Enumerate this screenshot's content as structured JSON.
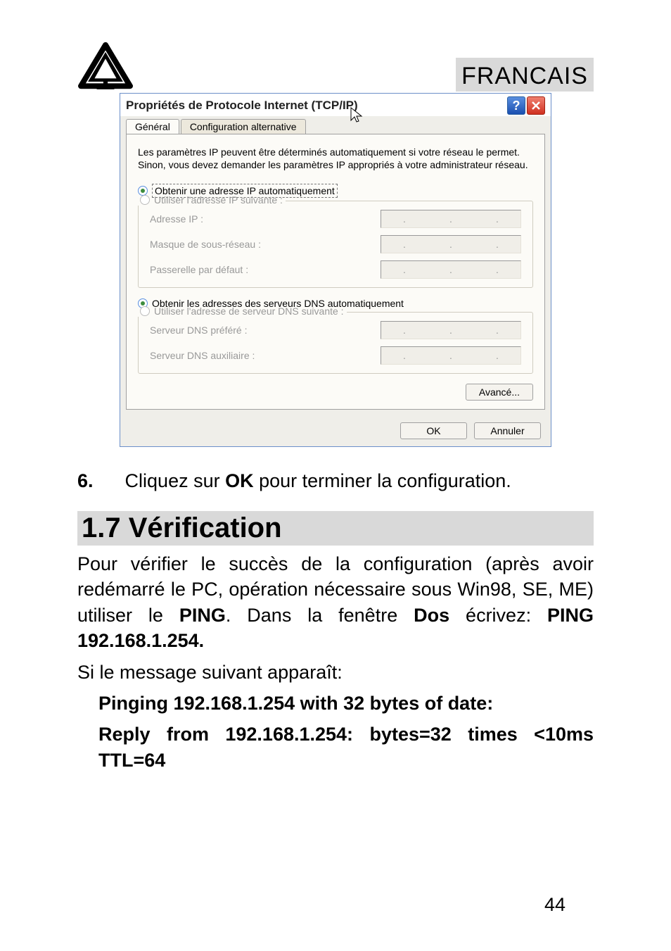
{
  "header": {
    "language": "FRANCAIS"
  },
  "dialog": {
    "title": "Propriétés de Protocole Internet (TCP/IP)",
    "tabs": [
      "Général",
      "Configuration alternative"
    ],
    "description": "Les paramètres IP peuvent être déterminés automatiquement si votre réseau le permet. Sinon, vous devez demander les paramètres IP appropriés à votre administrateur réseau.",
    "ip_section": {
      "radio_auto": "Obtenir une adresse IP automatiquement",
      "radio_manual": "Utiliser l'adresse IP suivante :",
      "rows": [
        "Adresse IP :",
        "Masque de sous-réseau :",
        "Passerelle par défaut :"
      ]
    },
    "dns_section": {
      "radio_auto": "Obtenir les adresses des serveurs DNS automatiquement",
      "radio_manual": "Utiliser l'adresse de serveur DNS suivante :",
      "rows": [
        "Serveur DNS préféré :",
        "Serveur DNS auxiliaire :"
      ]
    },
    "advanced_btn": "Avancé...",
    "ok_btn": "OK",
    "cancel_btn": "Annuler"
  },
  "step6": {
    "num": "6.",
    "pre": "Cliquez sur ",
    "ok": "OK",
    "post": " pour terminer la configuration."
  },
  "section": {
    "title": "1.7 Vérification",
    "p1a": "Pour vérifier le succès de la configuration (après avoir redémarré le PC, opération nécessaire sous Win98, SE, ME) utiliser le ",
    "ping": "PING",
    "p1b": ". Dans la fenêtre ",
    "dos": "Dos",
    "p1c": " écrivez: ",
    "cmd": "PING 192.168.1.254.",
    "p2": "Si le message suivant apparaît:",
    "line1": "Pinging 192.168.1.254 with 32 bytes of date:",
    "line2": "Reply from 192.168.1.254: bytes=32 times <10ms TTL=64"
  },
  "pagenum": "44",
  "ip_dot": "."
}
